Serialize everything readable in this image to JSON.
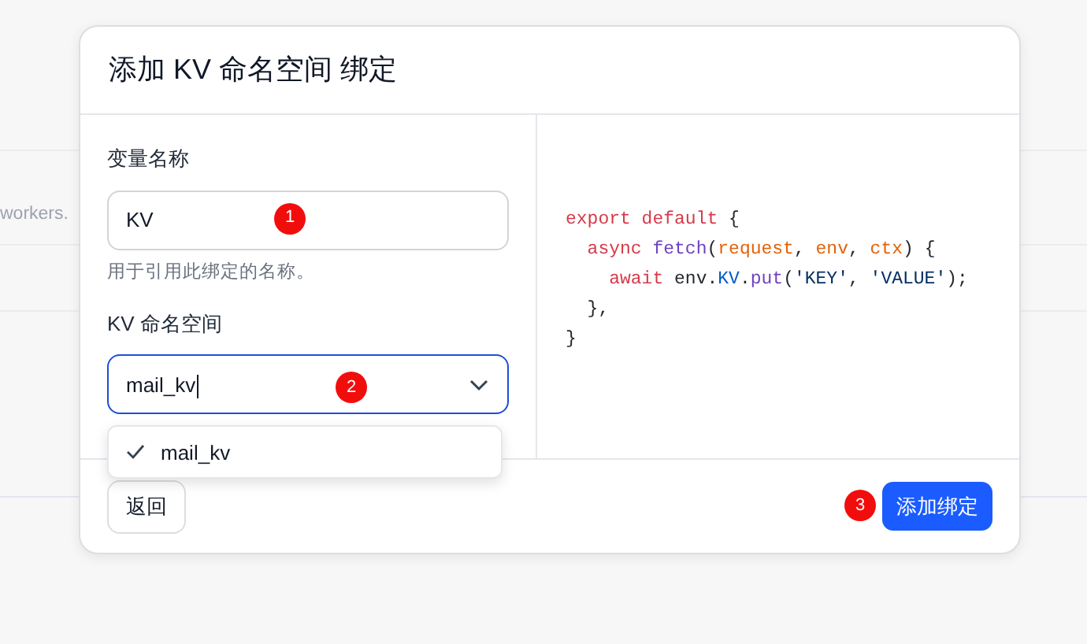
{
  "background": {
    "text": "workers."
  },
  "dialog": {
    "title": "添加 KV 命名空间 绑定",
    "fields": [
      {
        "kind": "text",
        "label": "变量名称",
        "value": "KV",
        "hint": "用于引用此绑定的名称。",
        "marker": "1"
      },
      {
        "kind": "select",
        "label": "KV 命名空间",
        "value": "mail_kv",
        "focused": true,
        "marker": "2",
        "options": [
          {
            "label": "mail_kv",
            "selected": true
          }
        ]
      }
    ],
    "code": [
      [
        {
          "kind": "keyword",
          "text": "export default "
        },
        {
          "kind": "plain",
          "text": "{"
        }
      ],
      [
        {
          "kind": "keyword",
          "text": "  async "
        },
        {
          "kind": "func",
          "text": "fetch"
        },
        {
          "kind": "plain",
          "text": "("
        },
        {
          "kind": "param",
          "text": "request"
        },
        {
          "kind": "plain",
          "text": ", "
        },
        {
          "kind": "param",
          "text": "env"
        },
        {
          "kind": "plain",
          "text": ", "
        },
        {
          "kind": "param",
          "text": "ctx"
        },
        {
          "kind": "plain",
          "text": ") {"
        }
      ],
      [
        {
          "kind": "keyword",
          "text": "    await "
        },
        {
          "kind": "plain",
          "text": "env."
        },
        {
          "kind": "prop",
          "text": "KV"
        },
        {
          "kind": "plain",
          "text": "."
        },
        {
          "kind": "func",
          "text": "put"
        },
        {
          "kind": "plain",
          "text": "("
        },
        {
          "kind": "string",
          "text": "'KEY'"
        },
        {
          "kind": "plain",
          "text": ", "
        },
        {
          "kind": "string",
          "text": "'VALUE'"
        },
        {
          "kind": "plain",
          "text": ");"
        }
      ],
      [
        {
          "kind": "plain",
          "text": "  },"
        }
      ],
      [
        {
          "kind": "plain",
          "text": "}"
        }
      ]
    ],
    "back_button": "返回",
    "submit_button": {
      "label": "添加绑定",
      "marker": "3"
    }
  }
}
